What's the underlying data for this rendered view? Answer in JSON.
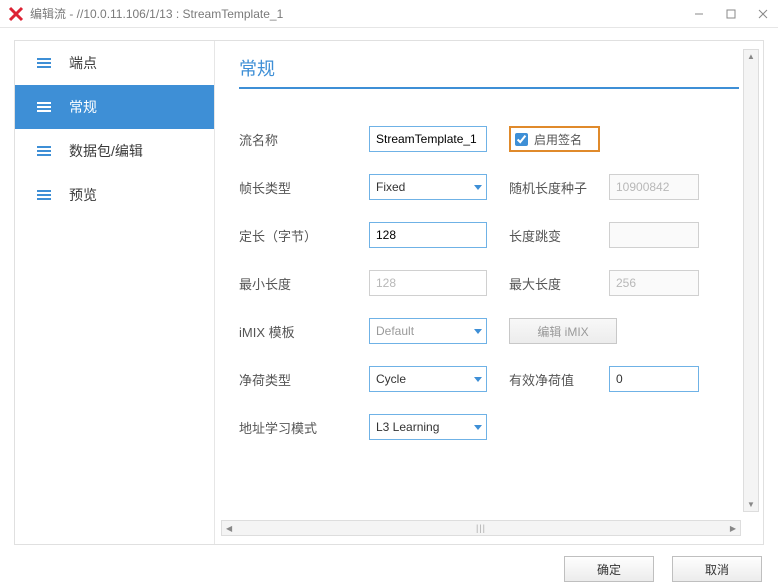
{
  "title": "编辑流 - //10.0.11.106/1/13 : StreamTemplate_1",
  "sidebar": {
    "items": [
      {
        "label": "端点"
      },
      {
        "label": "常规"
      },
      {
        "label": "数据包/编辑"
      },
      {
        "label": "预览"
      }
    ],
    "active_index": 1
  },
  "section_title": "常规",
  "form": {
    "stream_name": {
      "label": "流名称",
      "value": "StreamTemplate_1"
    },
    "signature": {
      "label": "启用签名",
      "checked": true
    },
    "frame_len_type": {
      "label": "帧长类型",
      "value": "Fixed"
    },
    "random_seed": {
      "label": "随机长度种子",
      "value": "10900842"
    },
    "fixed_len": {
      "label": "定长（字节）",
      "value": "128"
    },
    "len_jump": {
      "label": "长度跳变",
      "value": ""
    },
    "min_len": {
      "label": "最小长度",
      "value": "128"
    },
    "max_len": {
      "label": "最大长度",
      "value": "256"
    },
    "imix_tmpl": {
      "label": "iMIX 模板",
      "value": "Default"
    },
    "edit_imix_btn": "编辑 iMIX",
    "payload_type": {
      "label": "净荷类型",
      "value": "Cycle"
    },
    "payload_val": {
      "label": "有效净荷值",
      "value": "0"
    },
    "addr_learn": {
      "label": "地址学习模式",
      "value": "L3 Learning"
    }
  },
  "footer": {
    "ok": "确定",
    "cancel": "取消"
  }
}
